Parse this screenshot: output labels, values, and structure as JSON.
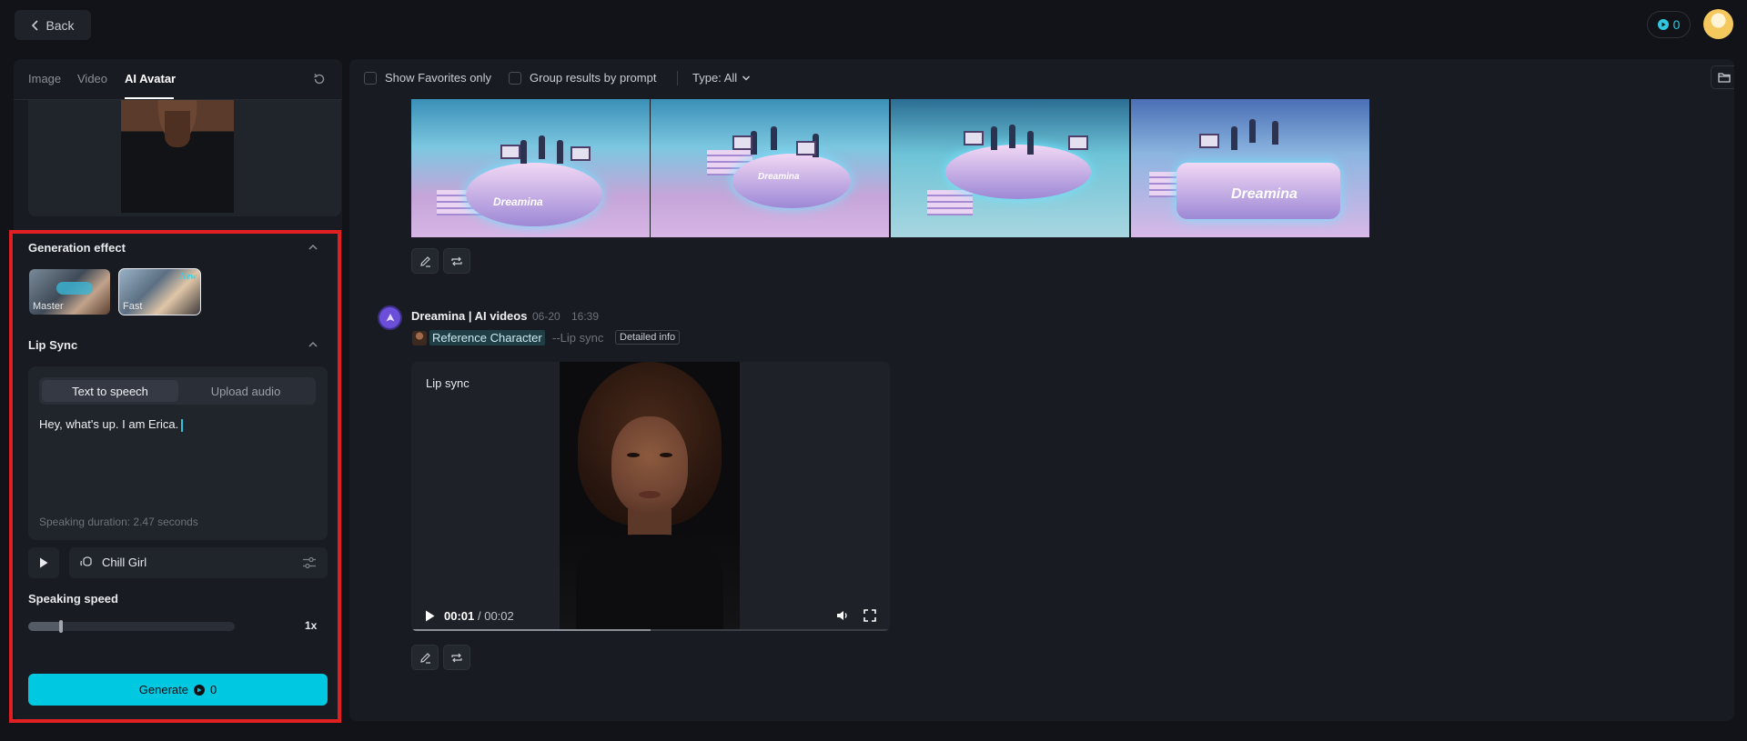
{
  "topbar": {
    "back_label": "Back",
    "credits": "0"
  },
  "left_panel": {
    "tabs": [
      {
        "label": "Image"
      },
      {
        "label": "Video"
      },
      {
        "label": "AI Avatar"
      }
    ],
    "generation_effect": {
      "title": "Generation effect",
      "options": [
        {
          "label": "Master"
        },
        {
          "label": "Fast",
          "badge": "New"
        }
      ],
      "selected": "Fast"
    },
    "lip_sync": {
      "title": "Lip Sync",
      "modes": [
        "Text to speech",
        "Upload audio"
      ],
      "active_mode": "Text to speech",
      "text": "Hey, what's up. I am Erica.",
      "duration": "Speaking duration: 2.47 seconds"
    },
    "voice": {
      "name": "Chill Girl"
    },
    "speaking_speed": {
      "label": "Speaking speed",
      "value": "1x",
      "level": 0.16
    },
    "generate": {
      "label": "Generate",
      "cost": "0"
    }
  },
  "main": {
    "filters": {
      "show_favorites": "Show Favorites only",
      "group_by_prompt": "Group results by prompt",
      "type_filter": "Type: All"
    },
    "image_results": [
      {
        "logo": "Dreamina"
      },
      {
        "logo": "Dreamina"
      },
      {
        "logo": ""
      },
      {
        "logo": "Dreamina"
      }
    ],
    "record": {
      "title": "Dreamina | AI videos",
      "date": "06-20",
      "time": "16:39",
      "reference": "Reference Character",
      "tag": "--Lip sync",
      "detail_label": "Detailed info",
      "video_label": "Lip sync",
      "current_time": "00:01",
      "total_time": "/ 00:02",
      "progress": 0.5
    }
  },
  "colors": {
    "accent": "#00c8e0",
    "highlight": "#e02020",
    "background": "#111318",
    "panel": "#181b21"
  }
}
